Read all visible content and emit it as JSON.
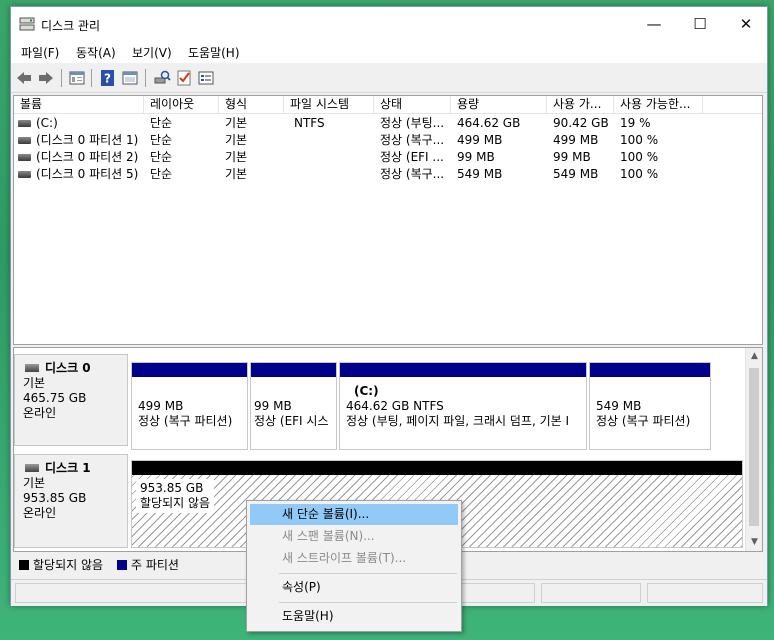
{
  "window": {
    "title": "디스크 관리",
    "controls": {
      "minimize": "—",
      "maximize": "☐",
      "close": "✕"
    }
  },
  "menu": [
    "파일(F)",
    "동작(A)",
    "보기(V)",
    "도움말(H)"
  ],
  "toolbar": [
    "back-arrow-icon",
    "forward-arrow-icon",
    "properties-icon",
    "help-icon",
    "show-hide-icon",
    "check-icon",
    "console-icon"
  ],
  "volumes": {
    "headers": [
      "볼륨",
      "레이아웃",
      "형식",
      "파일 시스템",
      "상태",
      "용량",
      "사용 가...",
      "사용 가능한..."
    ],
    "rows": [
      [
        "(C:)",
        "단순",
        "기본",
        "NTFS",
        "정상 (부팅...",
        "464.62 GB",
        "90.42 GB",
        "19 %"
      ],
      [
        "(디스크 0 파티션 1)",
        "단순",
        "기본",
        "",
        "정상 (복구...",
        "499 MB",
        "499 MB",
        "100 %"
      ],
      [
        "(디스크 0 파티션 2)",
        "단순",
        "기본",
        "",
        "정상 (EFI ...",
        "99 MB",
        "99 MB",
        "100 %"
      ],
      [
        "(디스크 0 파티션 5)",
        "단순",
        "기본",
        "",
        "정상 (복구...",
        "549 MB",
        "549 MB",
        "100 %"
      ]
    ]
  },
  "disks": [
    {
      "name": "디스크 0",
      "type": "기본",
      "size": "465.75 GB",
      "status": "온라인",
      "partitions": [
        {
          "name": "",
          "size": "499 MB",
          "status": "정상 (복구 파티션)"
        },
        {
          "name": "",
          "size": "99 MB",
          "status": "정상 (EFI 시스"
        },
        {
          "name": "(C:)",
          "size": "464.62 GB NTFS",
          "status": "정상 (부팅, 페이지 파일, 크래시 덤프, 기본 I"
        },
        {
          "name": "",
          "size": "549 MB",
          "status": "정상 (복구 파티션)"
        }
      ]
    },
    {
      "name": "디스크 1",
      "type": "기본",
      "size": "953.85 GB",
      "status": "온라인",
      "unallocated": {
        "size": "953.85 GB",
        "label": "할당되지 않음"
      }
    }
  ],
  "legend": [
    {
      "label": "할당되지 않음",
      "color": "#000000"
    },
    {
      "label": "주 파티션",
      "color": "#00008b"
    }
  ],
  "context_menu": {
    "items": [
      {
        "label": "새 단순 볼륨(I)...",
        "state": "highlighted"
      },
      {
        "label": "새 스팬 볼륨(N)...",
        "state": "disabled"
      },
      {
        "label": "새 스트라이프 볼륨(T)...",
        "state": "disabled"
      },
      {
        "label": "속성(P)",
        "state": "enabled"
      },
      {
        "label": "도움말(H)",
        "state": "enabled"
      }
    ]
  },
  "colors": {
    "primary_partition": "#00008b",
    "unallocated": "#000000",
    "menu_highlight": "#91c9f7"
  }
}
